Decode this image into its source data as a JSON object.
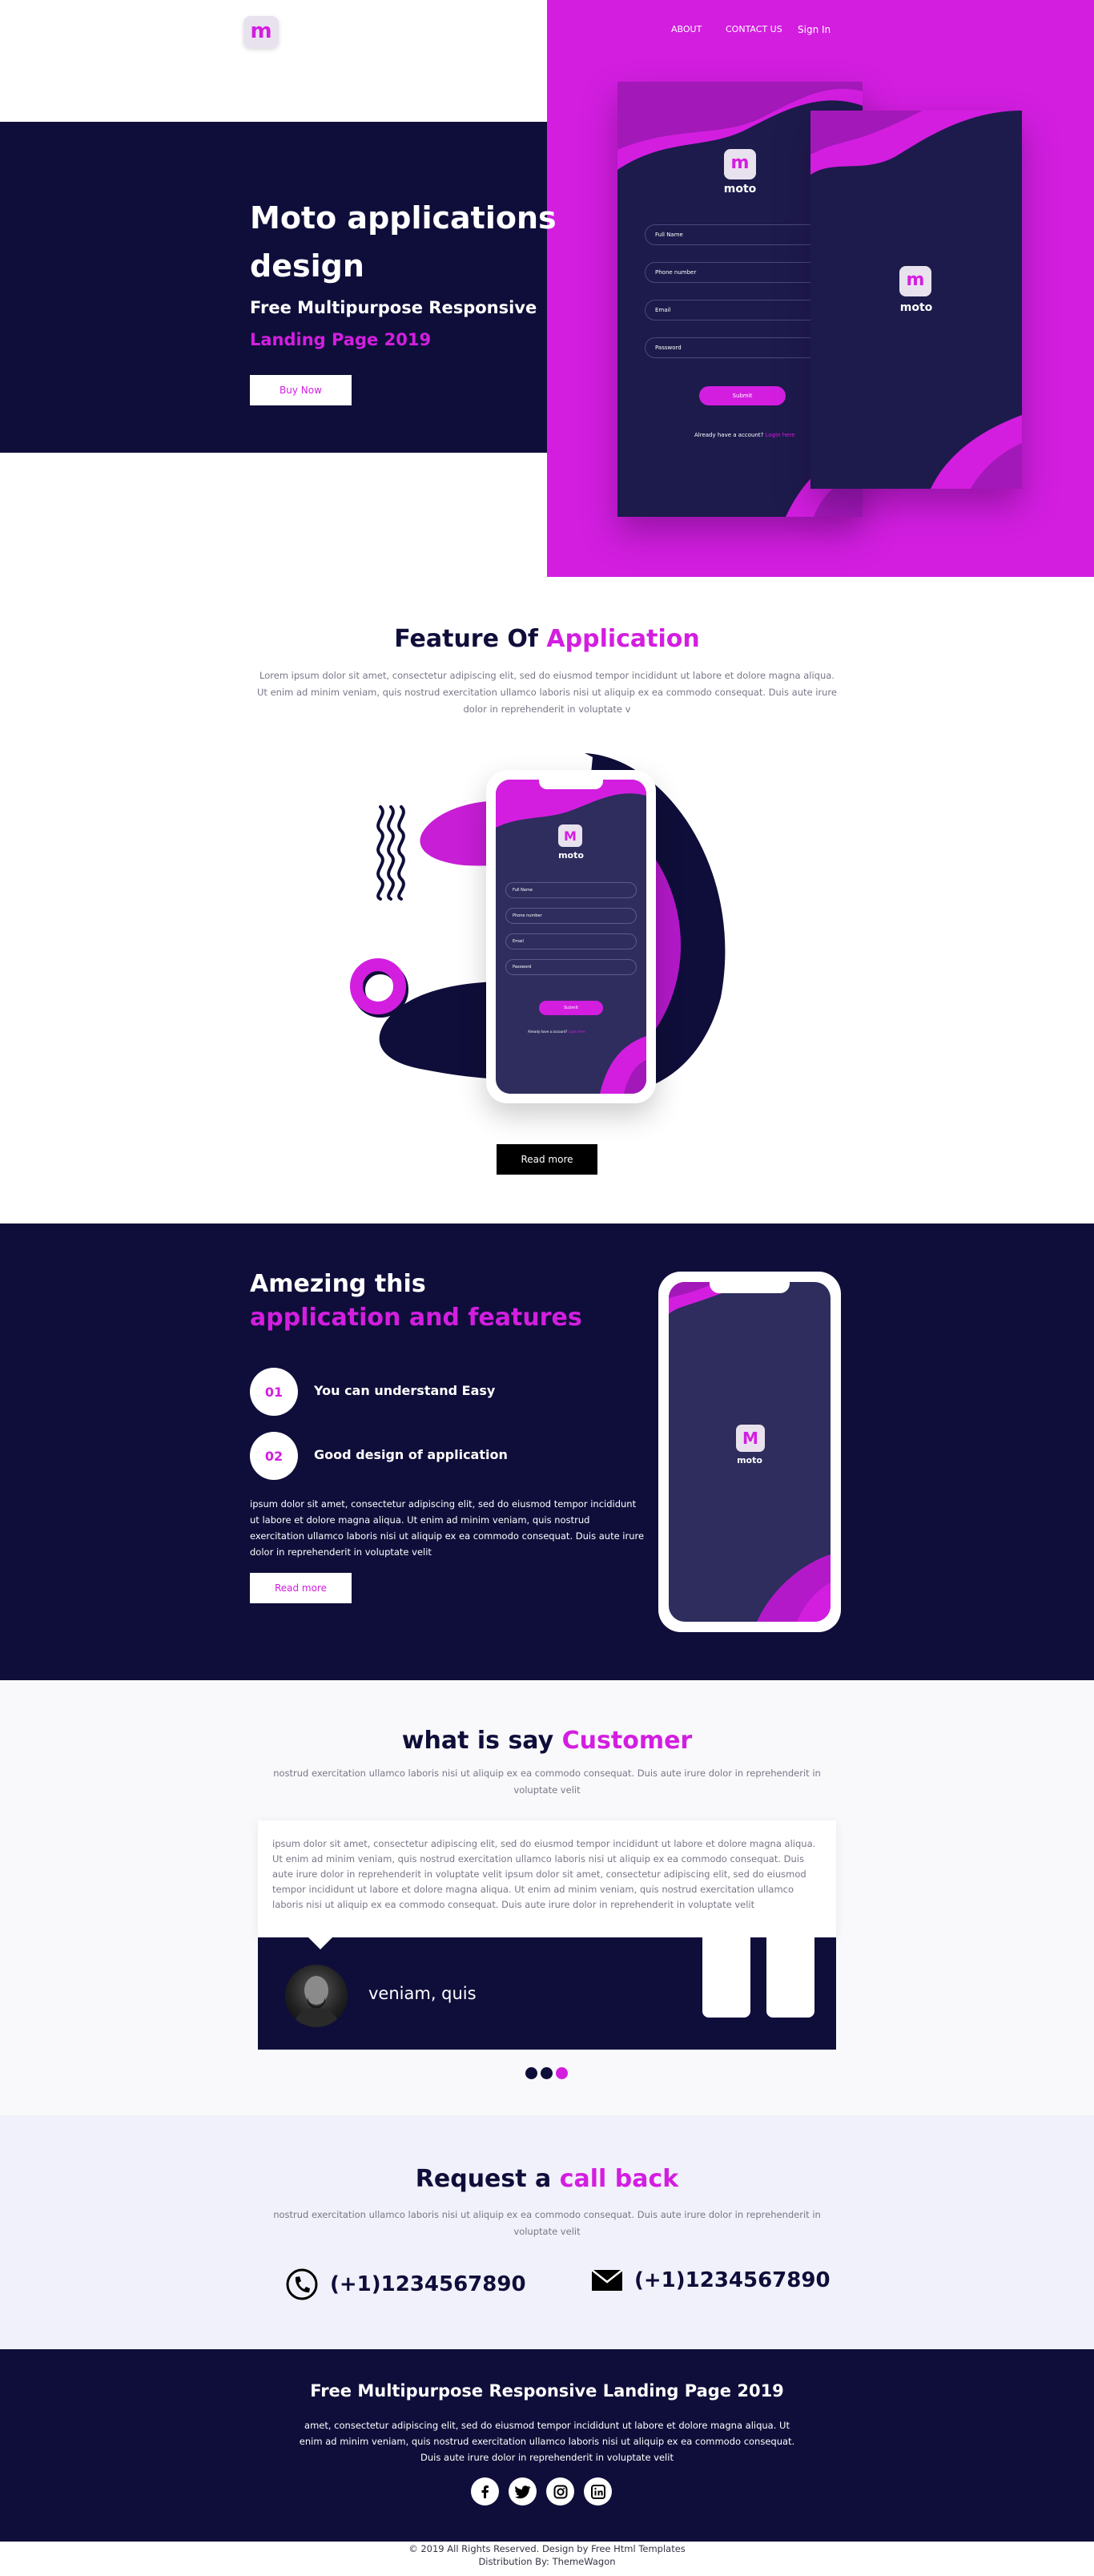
{
  "brand": {
    "logo_letter": "m",
    "accent": "#d31ee0",
    "navy": "#0f0e3a"
  },
  "nav": {
    "about": "ABOUT",
    "contact": "CONTACT US",
    "signin": "Sign In"
  },
  "hero": {
    "title": "Moto applications design",
    "subtitle_line1": "Free Multipurpose Responsive",
    "subtitle_line2": "Landing Page 2019",
    "button": "Buy Now"
  },
  "app_screen": {
    "name": "moto",
    "fields": [
      "Full Name",
      "Phone number",
      "Email",
      "Password"
    ],
    "submit": "Submit",
    "account_text": "Already have a account?",
    "account_link": "Login here"
  },
  "features": {
    "title": "Feature Of",
    "title_accent": "Application",
    "text": "Lorem ipsum dolor sit amet, consectetur adipiscing elit, sed do eiusmod tempor incididunt ut labore et dolore magna aliqua. Ut enim ad minim veniam, quis nostrud exercitation ullamco laboris nisi ut aliquip ex ea commodo consequat. Duis aute irure dolor in reprehenderit in voluptate v",
    "button": "Read more",
    "phone_logo_letter": "M",
    "phone_app_name": "moto"
  },
  "amazing": {
    "title_line1": "Amezing this",
    "title_line2": "application and features",
    "items": [
      {
        "num": "01",
        "label": "You can understand Easy"
      },
      {
        "num": "02",
        "label": "Good design of application"
      }
    ],
    "text": "ipsum dolor sit amet, consectetur adipiscing elit, sed do eiusmod tempor incididunt ut labore et dolore magna aliqua. Ut enim ad minim veniam, quis nostrud exercitation ullamco laboris nisi ut aliquip ex ea commodo consequat. Duis aute irure dolor in reprehenderit in voluptate velit",
    "button": "Read more",
    "phone_logo_letter": "M",
    "phone_app_name": "moto"
  },
  "testimonial": {
    "title": "what is say",
    "title_accent": "Customer",
    "subtitle": "nostrud exercitation ullamco laboris nisi ut aliquip ex ea commodo consequat. Duis aute irure dolor in reprehenderit in voluptate velit",
    "quote": "ipsum dolor sit amet, consectetur adipiscing elit, sed do eiusmod tempor incididunt ut labore et dolore magna aliqua. Ut enim ad minim veniam, quis nostrud exercitation ullamco laboris nisi ut aliquip ex ea commodo consequat. Duis aute irure dolor in reprehenderit in voluptate velit ipsum dolor sit amet, consectetur adipiscing elit, sed do eiusmod tempor incididunt ut labore et dolore magna aliqua. Ut enim ad minim veniam, quis nostrud exercitation ullamco laboris nisi ut aliquip ex ea commodo consequat. Duis aute irure dolor in reprehenderit in voluptate velit",
    "name": "veniam, quis"
  },
  "callback": {
    "title": "Request a",
    "title_accent": "call back",
    "text": "nostrud exercitation ullamco laboris nisi ut aliquip ex ea commodo consequat. Duis aute irure dolor in reprehenderit in voluptate velit",
    "phone": "(+1)1234567890",
    "email_phone": "(+1)1234567890"
  },
  "footer": {
    "title": "Free Multipurpose Responsive Landing Page 2019",
    "text": "amet, consectetur adipiscing elit, sed do eiusmod tempor incididunt ut labore et dolore magna aliqua. Ut enim ad minim veniam, quis nostrud exercitation ullamco laboris nisi ut aliquip ex ea commodo consequat. Duis aute irure dolor in reprehenderit in voluptate velit",
    "social_icons": [
      "facebook-icon",
      "twitter-icon",
      "instagram-icon",
      "linkedin-icon"
    ],
    "copyright": "© 2019 All Rights Reserved. Design by Free Html Templates",
    "distribution": "Distribution By: ThemeWagon"
  }
}
